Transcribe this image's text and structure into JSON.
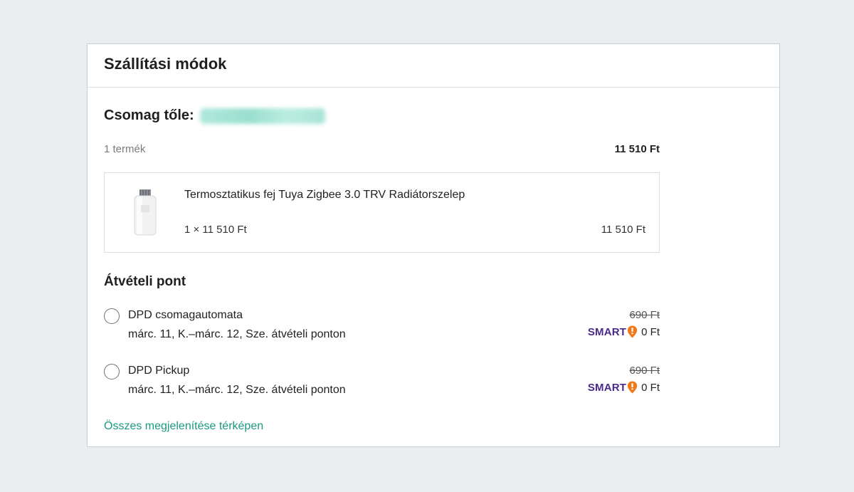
{
  "card": {
    "title": "Szállítási módok"
  },
  "package": {
    "label": "Csomag tőle:",
    "seller_name": "",
    "item_count": "1 termék",
    "total": "11 510 Ft"
  },
  "product": {
    "name": "Termosztatikus fej Tuya Zigbee 3.0 TRV Radiátorszelep",
    "qty_price": "1 × 11 510 Ft",
    "line_total": "11 510 Ft",
    "image_icon": "thermostat-head-image"
  },
  "pickup": {
    "title": "Átvételi pont",
    "options": [
      {
        "name": "DPD csomagautomata",
        "date": "márc. 11, K.–márc. 12, Sze. átvételi ponton",
        "old_price": "690 Ft",
        "smart_label": "SMART",
        "smart_price": "0 Ft",
        "selected": false
      },
      {
        "name": "DPD Pickup",
        "date": "márc. 11, K.–márc. 12, Sze. átvételi ponton",
        "old_price": "690 Ft",
        "smart_label": "SMART",
        "smart_price": "0 Ft",
        "selected": false
      }
    ],
    "map_link": "Összes megjelenítése térképen"
  },
  "colors": {
    "link": "#1a9a80",
    "smart_purple": "#4a2a8c",
    "smart_orange": "#f07a1a",
    "background": "#ebeef1"
  }
}
